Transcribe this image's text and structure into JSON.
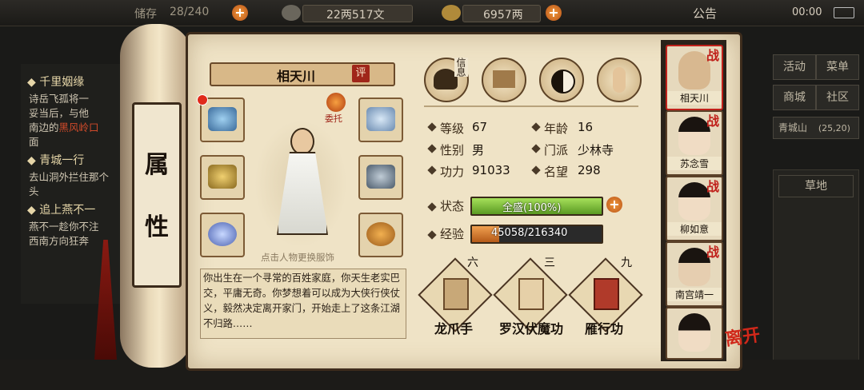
{
  "topbar": {
    "capacity_label": "储存",
    "capacity_value": "28/240",
    "silver": "22两517文",
    "gold": "6957两",
    "notice": "公告",
    "time": "00:00"
  },
  "quests": [
    {
      "title": "千里姻缘",
      "text_a": "诗岳飞孤将一",
      "text_b": "妥当后，与他",
      "text_c": "南边的",
      "red": "黑风岭口",
      "text_d": "面"
    },
    {
      "title": "青城一行",
      "text_a": "去山洞外拦住那个",
      "text_b": "头"
    },
    {
      "title": "追上燕不一",
      "text_a": "燕不一趁你不注",
      "text_b": "西南方向狂奔"
    }
  ],
  "right_menu": {
    "activity": "活动",
    "menu": "菜单",
    "shop": "商城",
    "community": "社区",
    "location": "青城山",
    "coords": "(25,20)",
    "terrain": "草地"
  },
  "scroll_label": [
    "属",
    "性"
  ],
  "character": {
    "name": "相天川",
    "rate_badge": "评",
    "entrust": "委托",
    "hint": "点击人物更换服饰",
    "description": "你出生在一个寻常的百姓家庭，你天生老实巴交，平庸无奇。你梦想着可以成为大侠行侠仗义，毅然决定离开家门，开始走上了这条江湖不归路……"
  },
  "tabs": [
    {
      "label": "信息",
      "icon": "info-hat-icon"
    },
    {
      "label": "",
      "icon": "inventory-scroll-icon"
    },
    {
      "label": "",
      "icon": "yinyang-bagua-icon"
    },
    {
      "label": "",
      "icon": "body-meridian-icon"
    }
  ],
  "stats": {
    "level_label": "等级",
    "level": "67",
    "age_label": "年龄",
    "age": "16",
    "gender_label": "性别",
    "gender": "男",
    "sect_label": "门派",
    "sect": "少林寺",
    "power_label": "功力",
    "power": "91033",
    "fame_label": "名望",
    "fame": "298",
    "status_label": "状态",
    "status_text": "全盛(100%)",
    "status_fraction": 1.0,
    "exp_label": "经验",
    "exp_text": "45058/216340",
    "exp_fraction": 0.208
  },
  "skills": [
    {
      "level": "六",
      "name": "龙爪手"
    },
    {
      "level": "三",
      "name": "罗汉伏魔功"
    },
    {
      "level": "九",
      "name": "雁行功"
    }
  ],
  "members": [
    {
      "name": "相天川",
      "battle": "战"
    },
    {
      "name": "苏念雪",
      "battle": "战"
    },
    {
      "name": "柳如意",
      "battle": "战"
    },
    {
      "name": "南宫靖一",
      "battle": "战"
    },
    {
      "name": "",
      "battle": ""
    }
  ],
  "leave": "离开",
  "colors": {
    "status_green": "#7cc23a",
    "exp_orange": "#d9822b",
    "accent_red": "#c0201a"
  }
}
